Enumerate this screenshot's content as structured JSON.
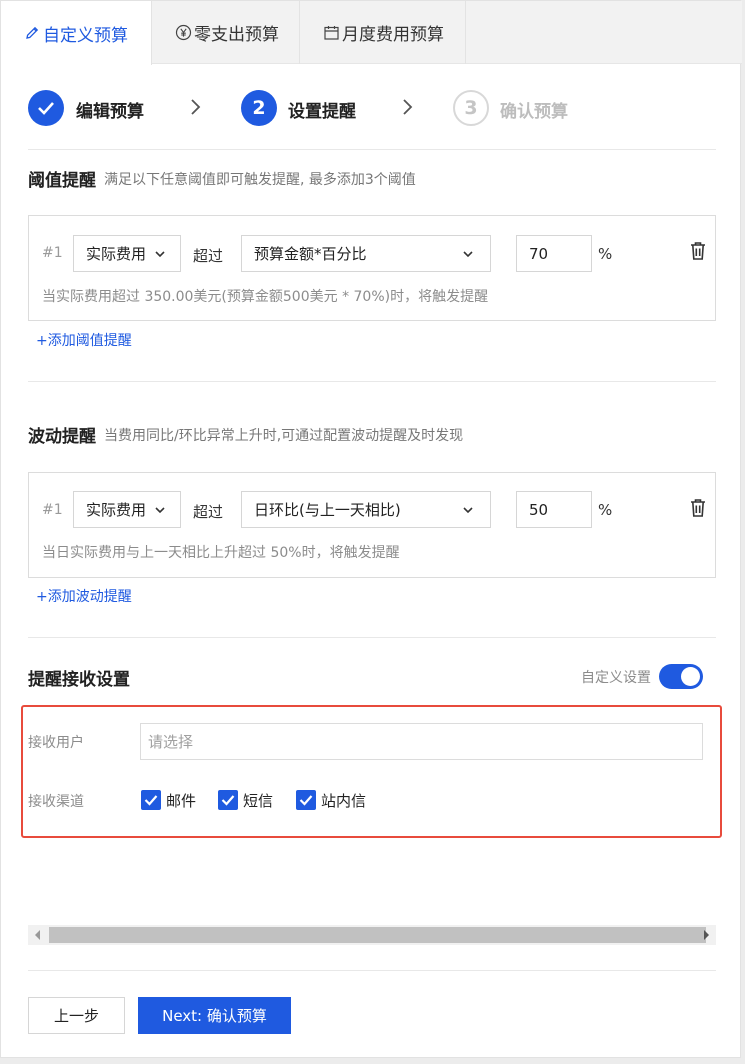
{
  "tabs": [
    {
      "label": "自定义预算",
      "icon": "pencil-icon",
      "active": true
    },
    {
      "label": "零支出预算",
      "icon": "yen-circle-icon",
      "active": false
    },
    {
      "label": "月度费用预算",
      "icon": "calendar-icon",
      "active": false
    }
  ],
  "steps": [
    {
      "number": "✓",
      "label": "编辑预算",
      "state": "done"
    },
    {
      "number": "2",
      "label": "设置提醒",
      "state": "current"
    },
    {
      "number": "3",
      "label": "确认预算",
      "state": "todo"
    }
  ],
  "threshold": {
    "title": "阈值提醒",
    "desc": "满足以下任意阈值即可触发提醒, 最多添加3个阈值",
    "rule": {
      "index": "#1",
      "metric": "实际费用",
      "op": "超过",
      "basis": "预算金额*百分比",
      "value": "70",
      "unit": "%",
      "hint": "当实际费用超过 350.00美元(预算金额500美元 * 70%)时，将触发提醒"
    },
    "add_label": "+添加阈值提醒"
  },
  "fluctuation": {
    "title": "波动提醒",
    "desc": "当费用同比/环比异常上升时,可通过配置波动提醒及时发现",
    "rule": {
      "index": "#1",
      "metric": "实际费用",
      "op": "超过",
      "basis": "日环比(与上一天相比)",
      "value": "50",
      "unit": "%",
      "hint": "当日实际费用与上一天相比上升超过 50%时，将触发提醒"
    },
    "add_label": "+添加波动提醒"
  },
  "receive": {
    "title": "提醒接收设置",
    "toggle_label": "自定义设置",
    "toggle_on": true,
    "users_label": "接收用户",
    "users_placeholder": "请选择",
    "channels_label": "接收渠道",
    "channels": [
      {
        "label": "邮件",
        "checked": true
      },
      {
        "label": "短信",
        "checked": true
      },
      {
        "label": "站内信",
        "checked": true
      }
    ]
  },
  "footer": {
    "prev_label": "上一步",
    "next_label": "Next: 确认预算"
  },
  "colors": {
    "accent": "#1f5ae0",
    "highlight_border": "#e84b3c"
  }
}
